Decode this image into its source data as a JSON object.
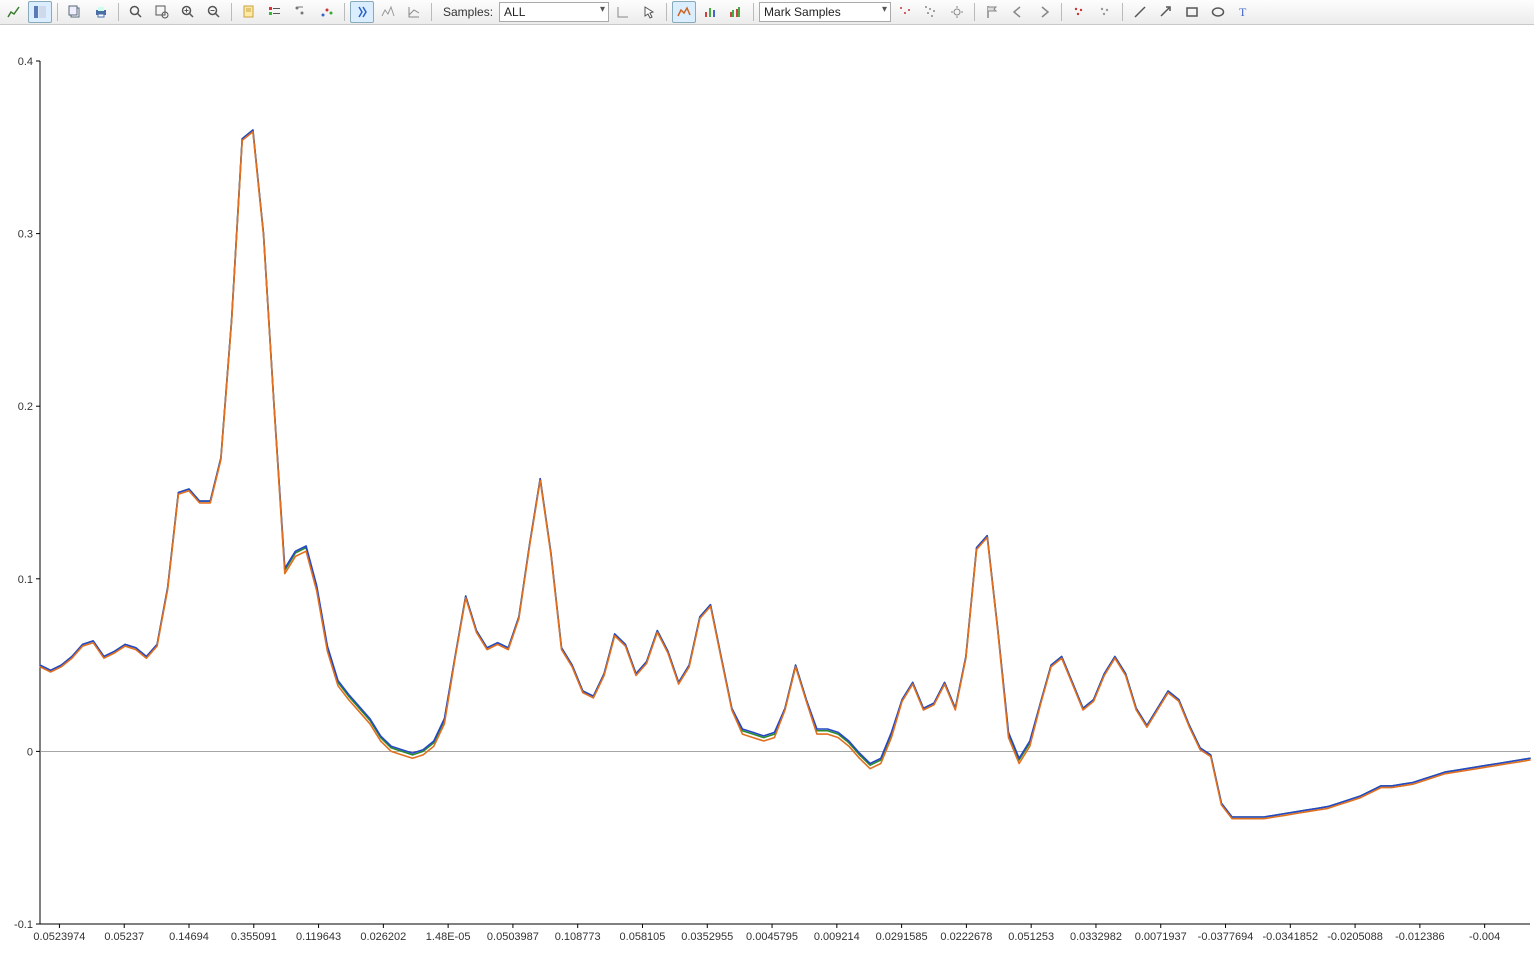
{
  "toolbar": {
    "samples_label": "Samples:",
    "samples_value": "ALL",
    "mark_label": "Mark Samples"
  },
  "chart_data": {
    "type": "line",
    "title": "",
    "xlabel": "",
    "ylabel": "",
    "ylim": [
      -0.1,
      0.4
    ],
    "xlim": [
      0,
      140
    ],
    "x_tick_positions": [
      3,
      12,
      21,
      30,
      39,
      48,
      57,
      66,
      75,
      84,
      93,
      102,
      111,
      119,
      128,
      137
    ],
    "x_tick_labels": [
      "0.0523974",
      "0.05237",
      "0.14694",
      "0.355091",
      "0.119643",
      "0.026202",
      "1.48E-05",
      "0.0503987",
      "0.108773",
      "0.058105",
      "0.0352955",
      "0.0045795",
      "0.009214",
      "0.0291585",
      "0.0222678",
      "0.051253",
      "0.0332982",
      "0.0071937",
      "-0.0377694",
      "-0.0341852",
      "-0.0205088",
      "-0.012386",
      "-0.004"
    ],
    "y_ticks": [
      -0.1,
      0,
      0.1,
      0.2,
      0.3,
      0.4
    ],
    "series": [
      {
        "name": "green",
        "color": "#2a8a2a",
        "values": [
          0.05,
          0.047,
          0.05,
          0.055,
          0.062,
          0.064,
          0.055,
          0.058,
          0.062,
          0.06,
          0.055,
          0.062,
          0.095,
          0.15,
          0.152,
          0.145,
          0.145,
          0.17,
          0.25,
          0.355,
          0.36,
          0.3,
          0.2,
          0.105,
          0.115,
          0.118,
          0.095,
          0.06,
          0.04,
          0.032,
          0.025,
          0.018,
          0.008,
          0.002,
          0.0,
          -0.002,
          0.0,
          0.005,
          0.018,
          0.055,
          0.09,
          0.07,
          0.06,
          0.063,
          0.06,
          0.078,
          0.12,
          0.158,
          0.115,
          0.06,
          0.05,
          0.035,
          0.032,
          0.045,
          0.068,
          0.062,
          0.045,
          0.052,
          0.07,
          0.058,
          0.04,
          0.05,
          0.078,
          0.085,
          0.055,
          0.025,
          0.012,
          0.01,
          0.008,
          0.01,
          0.025,
          0.05,
          0.03,
          0.012,
          0.012,
          0.01,
          0.005,
          -0.002,
          -0.008,
          -0.005,
          0.01,
          0.03,
          0.04,
          0.025,
          0.028,
          0.04,
          0.025,
          0.055,
          0.118,
          0.125,
          0.07,
          0.01,
          -0.005,
          0.005,
          0.028,
          0.05,
          0.055,
          0.04,
          0.025,
          0.03,
          0.045,
          0.055,
          0.045,
          0.025,
          0.015,
          0.025,
          0.035,
          0.03,
          0.015,
          0.002,
          -0.002,
          -0.03,
          -0.038,
          -0.038,
          -0.038,
          -0.038,
          -0.037,
          -0.036,
          -0.035,
          -0.034,
          -0.033,
          -0.032,
          -0.03,
          -0.028,
          -0.026,
          -0.023,
          -0.02,
          -0.02,
          -0.019,
          -0.018,
          -0.016,
          -0.014,
          -0.012,
          -0.011,
          -0.01,
          -0.009,
          -0.008,
          -0.007,
          -0.006,
          -0.005,
          -0.004
        ]
      },
      {
        "name": "blue",
        "color": "#2648c8",
        "values": [
          0.05,
          0.047,
          0.05,
          0.055,
          0.062,
          0.064,
          0.055,
          0.058,
          0.062,
          0.06,
          0.055,
          0.062,
          0.095,
          0.15,
          0.152,
          0.145,
          0.145,
          0.17,
          0.25,
          0.355,
          0.36,
          0.3,
          0.2,
          0.106,
          0.116,
          0.119,
          0.096,
          0.061,
          0.041,
          0.033,
          0.026,
          0.019,
          0.009,
          0.003,
          0.001,
          -0.001,
          0.001,
          0.006,
          0.019,
          0.055,
          0.09,
          0.07,
          0.06,
          0.063,
          0.06,
          0.078,
          0.12,
          0.158,
          0.115,
          0.06,
          0.05,
          0.035,
          0.032,
          0.045,
          0.068,
          0.062,
          0.045,
          0.052,
          0.07,
          0.058,
          0.04,
          0.05,
          0.078,
          0.085,
          0.055,
          0.025,
          0.013,
          0.011,
          0.009,
          0.011,
          0.025,
          0.05,
          0.03,
          0.013,
          0.013,
          0.011,
          0.006,
          -0.001,
          -0.007,
          -0.004,
          0.011,
          0.03,
          0.04,
          0.025,
          0.028,
          0.04,
          0.025,
          0.055,
          0.118,
          0.125,
          0.07,
          0.011,
          -0.004,
          0.006,
          0.028,
          0.05,
          0.055,
          0.04,
          0.025,
          0.03,
          0.045,
          0.055,
          0.045,
          0.025,
          0.015,
          0.025,
          0.035,
          0.03,
          0.015,
          0.002,
          -0.002,
          -0.03,
          -0.038,
          -0.038,
          -0.038,
          -0.038,
          -0.037,
          -0.036,
          -0.035,
          -0.034,
          -0.033,
          -0.032,
          -0.03,
          -0.028,
          -0.026,
          -0.023,
          -0.02,
          -0.02,
          -0.019,
          -0.018,
          -0.016,
          -0.014,
          -0.012,
          -0.011,
          -0.01,
          -0.009,
          -0.008,
          -0.007,
          -0.006,
          -0.005,
          -0.004
        ]
      },
      {
        "name": "orange",
        "color": "#e07020",
        "values": [
          0.049,
          0.046,
          0.049,
          0.054,
          0.061,
          0.063,
          0.054,
          0.057,
          0.061,
          0.059,
          0.054,
          0.061,
          0.094,
          0.149,
          0.151,
          0.144,
          0.144,
          0.169,
          0.249,
          0.354,
          0.359,
          0.299,
          0.199,
          0.103,
          0.113,
          0.116,
          0.093,
          0.058,
          0.038,
          0.03,
          0.023,
          0.016,
          0.006,
          0.0,
          -0.002,
          -0.004,
          -0.002,
          0.003,
          0.016,
          0.054,
          0.089,
          0.069,
          0.059,
          0.062,
          0.059,
          0.077,
          0.119,
          0.157,
          0.114,
          0.059,
          0.049,
          0.034,
          0.031,
          0.044,
          0.067,
          0.061,
          0.044,
          0.051,
          0.069,
          0.057,
          0.039,
          0.049,
          0.077,
          0.084,
          0.054,
          0.024,
          0.01,
          0.008,
          0.006,
          0.008,
          0.024,
          0.049,
          0.029,
          0.01,
          0.01,
          0.008,
          0.003,
          -0.004,
          -0.01,
          -0.007,
          0.008,
          0.029,
          0.039,
          0.024,
          0.027,
          0.039,
          0.024,
          0.054,
          0.117,
          0.124,
          0.069,
          0.008,
          -0.007,
          0.003,
          0.027,
          0.049,
          0.054,
          0.039,
          0.024,
          0.029,
          0.044,
          0.054,
          0.044,
          0.024,
          0.014,
          0.024,
          0.034,
          0.029,
          0.014,
          0.001,
          -0.003,
          -0.031,
          -0.039,
          -0.039,
          -0.039,
          -0.039,
          -0.038,
          -0.037,
          -0.036,
          -0.035,
          -0.034,
          -0.033,
          -0.031,
          -0.029,
          -0.027,
          -0.024,
          -0.021,
          -0.021,
          -0.02,
          -0.019,
          -0.017,
          -0.015,
          -0.013,
          -0.012,
          -0.011,
          -0.01,
          -0.009,
          -0.008,
          -0.007,
          -0.006,
          -0.005
        ]
      }
    ]
  }
}
